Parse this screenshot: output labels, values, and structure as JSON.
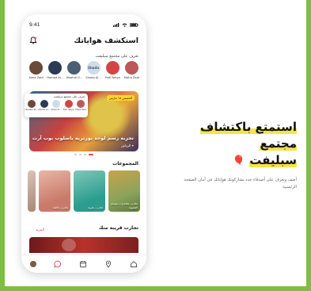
{
  "status": {
    "time": "9:41"
  },
  "header": {
    "title": "استكشف هواياتك"
  },
  "suggest": {
    "label": "تعرف على مجتمع سبليفت",
    "people": [
      {
        "name": "Areia Zaid",
        "color": "#6a4a3a"
      },
      {
        "name": "Hamad Al...",
        "color": "#2d3a55"
      },
      {
        "name": "Alkahdi O...",
        "color": "#4a5f70"
      },
      {
        "name": "Shada Al...",
        "color": "#cfdbe6",
        "badge": "Shada"
      },
      {
        "name": "Fadi Yahya",
        "color": "#d24545"
      },
      {
        "name": "Maha Zaid",
        "color": "#b85a5a"
      }
    ]
  },
  "popup": {
    "label": "تعرف على مجتمع سبليفت",
    "people": [
      {
        "name": "Hussein Sh...",
        "color": "#6a4a3a"
      },
      {
        "name": "Ahmed Al...",
        "color": "#2d3a55"
      },
      {
        "name": "Shadi Al...",
        "color": "#cfdbe6"
      },
      {
        "name": "Fadi Yahya",
        "color": "#d24545"
      },
      {
        "name": "Maha Zaid",
        "color": "#b85a5a"
      }
    ]
  },
  "hero": {
    "caption": "تجربة رسم لوحة بورتريه باسلوب بوب آرت",
    "location": "الرياض",
    "tag": "الخميس ١٥ مارس"
  },
  "groups": {
    "title": "المجموعات",
    "items": [
      {
        "label": "تجارب مغامرات موسم الشتوية",
        "colors": [
          "#8aa35a",
          "#c9a34e"
        ]
      },
      {
        "label": "تجارب بحرية",
        "colors": [
          "#2a9d8f",
          "#7fc8b8"
        ]
      },
      {
        "label": "تجارب عائلية",
        "colors": [
          "#c97a6a",
          "#e8b7a8"
        ]
      },
      {
        "label": "",
        "colors": [
          "#d8c3b5",
          "#a98977"
        ]
      }
    ]
  },
  "nearby": {
    "title": "تجارب قريبة منك",
    "more": "المزيد"
  },
  "promo": {
    "title_line1": "استمتع باكتشاف مجتمع",
    "title_line2": "سبليفت",
    "title_emoji": "🎈",
    "description": "أضف وتعرف على أصدقاء جدد يشاركونك هواياتك في أمان الصفحة الرئيسية"
  },
  "colors": {
    "accent": "#e8474d",
    "border": "#7ebf3f",
    "highlight": "#f7e24a"
  }
}
